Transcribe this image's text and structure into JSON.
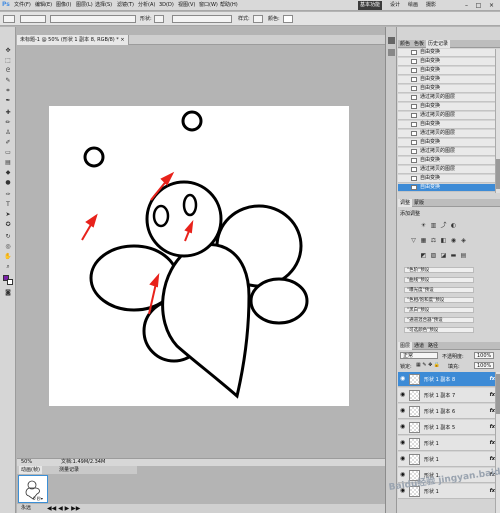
{
  "app": {
    "logo": "Ps",
    "menus": [
      "文件(F)",
      "编辑(E)",
      "图像(I)",
      "图层(L)",
      "选择(S)",
      "滤镜(T)",
      "分析(A)",
      "3D(D)",
      "视图(V)",
      "窗口(W)",
      "帮助(H)"
    ],
    "zoom": "50%",
    "workspaces": [
      "基本功能",
      "设计",
      "绘画",
      "摄影"
    ],
    "active_workspace": "基本功能",
    "window_controls": [
      "–",
      "□",
      "×"
    ]
  },
  "options": {
    "tool_label": "形状:",
    "style_label": "样式:",
    "color_label": "颜色:"
  },
  "document": {
    "tab": "未标题-1 @ 50% (形状 1 副本 8, RGB/8) * ×",
    "zoom_status": "50%",
    "doc_size": "文档:1.49M/2.34M"
  },
  "mini_panel": {
    "tabs": [
      "动画(帧)",
      "测量记录"
    ],
    "frame_delay": "0 秒▾",
    "loop": "永远"
  },
  "history": {
    "tabs": [
      "颜色",
      "色板",
      "历史记录"
    ],
    "active_tab": "历史记录",
    "items": [
      "自由变换",
      "自由变换",
      "自由变换",
      "自由变换",
      "自由变换",
      "通过拷贝的图层",
      "自由变换",
      "通过拷贝的图层",
      "自由变换",
      "通过拷贝的图层",
      "自由变换",
      "通过拷贝的图层",
      "自由变换",
      "通过拷贝的图层",
      "自由变换",
      "自由变换"
    ],
    "selected_index": 15
  },
  "adjustments": {
    "tabs": [
      "调整",
      "蒙版"
    ],
    "title": "添加调整",
    "presets": [
      "\"色阶\"预设",
      "\"曲线\"预设",
      "\"曝光度\"预设",
      "\"色相/饱和度\"预设",
      "\"黑白\"预设",
      "\"通道混合器\"预设",
      "\"可选颜色\"预设"
    ]
  },
  "layers": {
    "tabs": [
      "图层",
      "通道",
      "路径"
    ],
    "blend_mode": "正常",
    "opacity_label": "不透明度:",
    "opacity": "100%",
    "lock_label": "锁定:",
    "fill_label": "填充:",
    "fill": "100%",
    "items": [
      {
        "name": "形状 1 副本 8",
        "fx": "fx",
        "selected": true
      },
      {
        "name": "形状 1 副本 7",
        "fx": "fx",
        "selected": false
      },
      {
        "name": "形状 1 副本 6",
        "fx": "fx",
        "selected": false
      },
      {
        "name": "形状 1 副本 5",
        "fx": "fx",
        "selected": false
      },
      {
        "name": "形状 1",
        "fx": "fx",
        "selected": false
      },
      {
        "name": "形状 1",
        "fx": "fx",
        "selected": false
      },
      {
        "name": "形状 1",
        "fx": "fx",
        "selected": false
      },
      {
        "name": "形状 1",
        "fx": "fx",
        "selected": false
      }
    ]
  },
  "watermark": "Baidu经验 jingyan.baidu.com",
  "colors": {
    "accent": "#3d8bd6",
    "arrow": "#e8221b",
    "foreground": "#7a1fa8",
    "background": "#ffffff"
  }
}
